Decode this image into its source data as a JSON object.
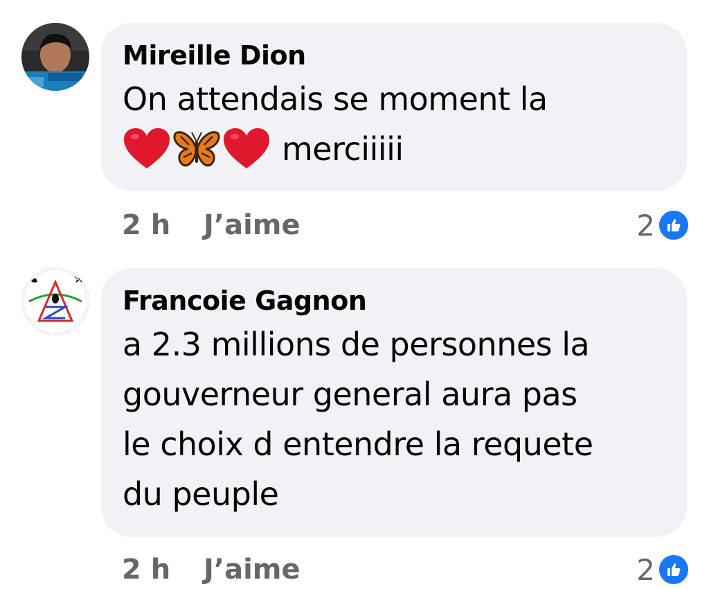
{
  "comments": [
    {
      "author": "Mireille Dion",
      "text_line1": "On attendais se moment la",
      "text_line2": "merciiiii",
      "emojis": [
        "red-heart",
        "butterfly",
        "red-heart"
      ],
      "time": "2 h",
      "like_label": "J’aime",
      "reaction_count": "2",
      "reaction_type": "like-icon"
    },
    {
      "author": "Francoie Gagnon",
      "text": "a 2.3 millions de personnes la\ngouverneur general aura pas\nle choix d entendre la requete\ndu peuple",
      "time": "2 h",
      "like_label": "J’aime",
      "reaction_count": "2",
      "reaction_type": "like-icon"
    }
  ],
  "colors": {
    "bubble": "#f0f2f5",
    "meta_text": "#65676b",
    "like_blue": "#1877f2",
    "heart_red": "#e0182d",
    "butterfly_orange": "#e87a1c"
  }
}
